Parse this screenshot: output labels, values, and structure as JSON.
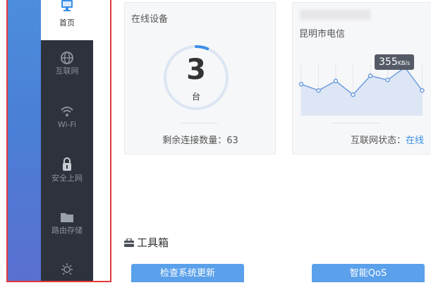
{
  "sidebar": {
    "items": [
      {
        "label": "首页",
        "icon": "monitor-icon"
      },
      {
        "label": "互联网",
        "icon": "globe-icon"
      },
      {
        "label": "Wi-Fi",
        "icon": "wifi-icon"
      },
      {
        "label": "安全上网",
        "icon": "lock-icon"
      },
      {
        "label": "路由存储",
        "icon": "folder-icon"
      },
      {
        "icon": "sun-icon"
      }
    ]
  },
  "devices_card": {
    "title": "在线设备",
    "count": "3",
    "unit": "台",
    "remaining": "剩余连接数量：63",
    "ring_fill_fraction": 0.06
  },
  "internet_card": {
    "isp": "昆明市电信",
    "speed_value": "355",
    "speed_unit": "KB/s",
    "status_label": "互联网状态：",
    "status_value": "在线",
    "chart_data": {
      "type": "line",
      "values": [
        30,
        24,
        33,
        20,
        38,
        34,
        46,
        24
      ]
    }
  },
  "toolbox": {
    "title": "工具箱",
    "buttons": [
      "检查系统更新",
      "智能QoS"
    ]
  },
  "colors": {
    "accent": "#3a8ee6",
    "sidebar_bg": "#2d323c",
    "guide_red": "#e53a3a",
    "button_blue": "#5aa0ea"
  }
}
